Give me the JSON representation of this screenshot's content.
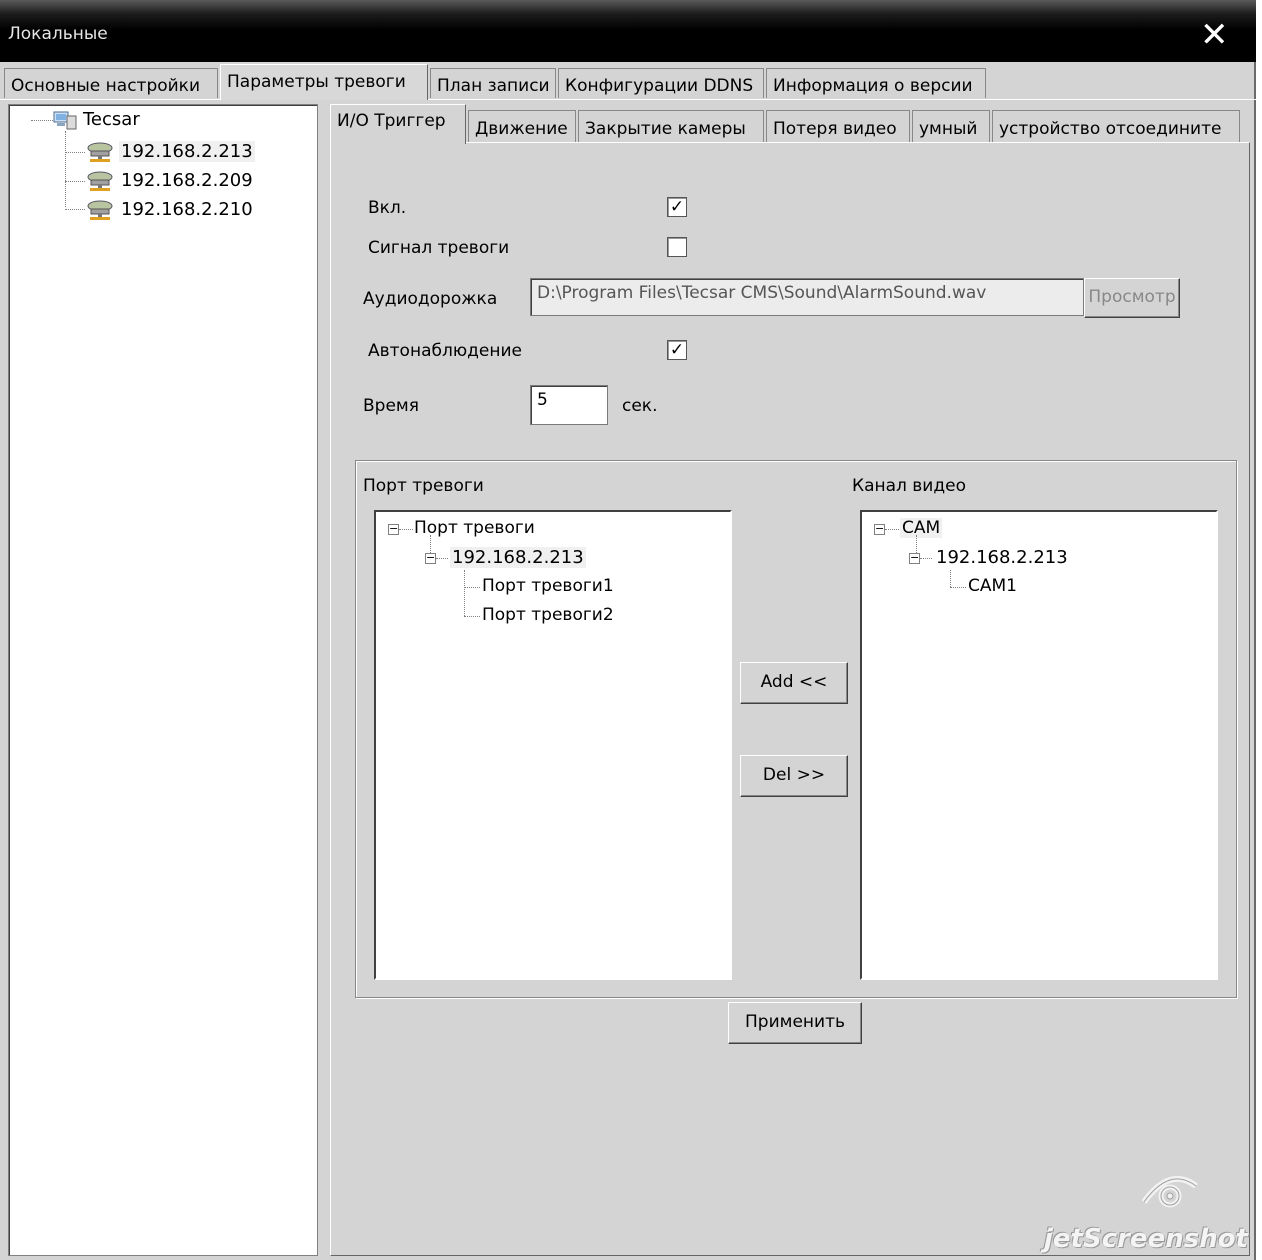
{
  "window": {
    "title": "Локальные",
    "close_glyph": "✕"
  },
  "main_tabs": [
    {
      "label": "Основные настройки"
    },
    {
      "label": "Параметры тревоги"
    },
    {
      "label": "План записи"
    },
    {
      "label": "Конфигурации DDNS"
    },
    {
      "label": "Информация о версии"
    }
  ],
  "device_tree": {
    "root": "Tecsar",
    "root_icon": "server-icon",
    "device_icon": "network-device-icon",
    "devices": [
      "192.168.2.213",
      "192.168.2.209",
      "192.168.2.210"
    ],
    "selected": "192.168.2.213"
  },
  "sub_tabs": [
    {
      "label": "И/О Триггер"
    },
    {
      "label": "Движение"
    },
    {
      "label": "Закрытие камеры"
    },
    {
      "label": "Потеря видео"
    },
    {
      "label": "умный"
    },
    {
      "label": "устройство отсоедините"
    }
  ],
  "form": {
    "enable_label": "Вкл.",
    "enable_checked": true,
    "alarm_signal_label": "Сигнал тревоги",
    "alarm_signal_checked": false,
    "audio_label": "Аудиодорожка",
    "audio_path": "D:\\Program Files\\Tecsar CMS\\Sound\\AlarmSound.wav",
    "browse_label": "Просмотр",
    "autoview_label": "Автонаблюдение",
    "autoview_checked": true,
    "time_label": "Время",
    "time_value": "5",
    "time_unit": "сек."
  },
  "alarm_port": {
    "header": "Порт тревоги",
    "tree": {
      "root": "Порт тревоги",
      "device": "192.168.2.213",
      "children": [
        "Порт тревоги1",
        "Порт тревоги2"
      ]
    }
  },
  "video_channel": {
    "header": "Канал видео",
    "tree": {
      "root": "CAM",
      "device": "192.168.2.213",
      "children": [
        "CAM1"
      ]
    }
  },
  "buttons": {
    "add": "Add <<",
    "del": "Del >>",
    "apply": "Применить"
  },
  "watermark": "jetScreenshot"
}
